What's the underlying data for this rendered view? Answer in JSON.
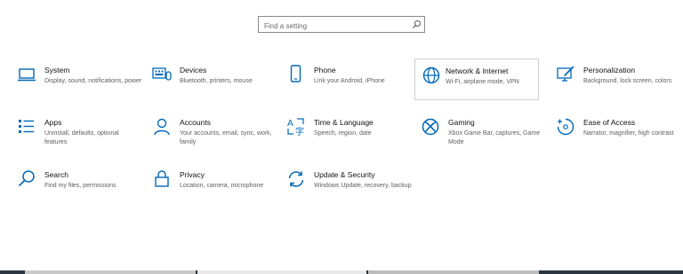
{
  "search": {
    "placeholder": "Find a setting",
    "icon": "search-icon"
  },
  "categories": [
    {
      "title": "System",
      "desc": "Display, sound, notifications, power",
      "icon": "laptop-icon"
    },
    {
      "title": "Devices",
      "desc": "Bluetooth, printers, mouse",
      "icon": "keyboard-icon"
    },
    {
      "title": "Phone",
      "desc": "Link your Android, iPhone",
      "icon": "phone-icon"
    },
    {
      "title": "Network & Internet",
      "desc": "Wi-Fi, airplane mode, VPN",
      "icon": "globe-icon"
    },
    {
      "title": "Personalization",
      "desc": "Background, lock screen, colors",
      "icon": "paint-icon"
    },
    {
      "title": "Apps",
      "desc": "Uninstall, defaults, optional features",
      "icon": "apps-list-icon"
    },
    {
      "title": "Accounts",
      "desc": "Your accounts, email, sync, work, family",
      "icon": "person-icon"
    },
    {
      "title": "Time & Language",
      "desc": "Speech, region, date",
      "icon": "time-language-icon"
    },
    {
      "title": "Gaming",
      "desc": "Xbox Game Bar, captures, Game Mode",
      "icon": "xbox-icon"
    },
    {
      "title": "Ease of Access",
      "desc": "Narrator, magnifier, high contrast",
      "icon": "ease-of-access-icon"
    },
    {
      "title": "Search",
      "desc": "Find my files, permissions",
      "icon": "magnifier-icon"
    },
    {
      "title": "Privacy",
      "desc": "Location, camera, microphone",
      "icon": "lock-icon"
    },
    {
      "title": "Update & Security",
      "desc": "Windows Update, recovery, backup",
      "icon": "sync-icon"
    }
  ],
  "colors": {
    "accent": "#0067b8",
    "taskbar": "#2a3540"
  }
}
